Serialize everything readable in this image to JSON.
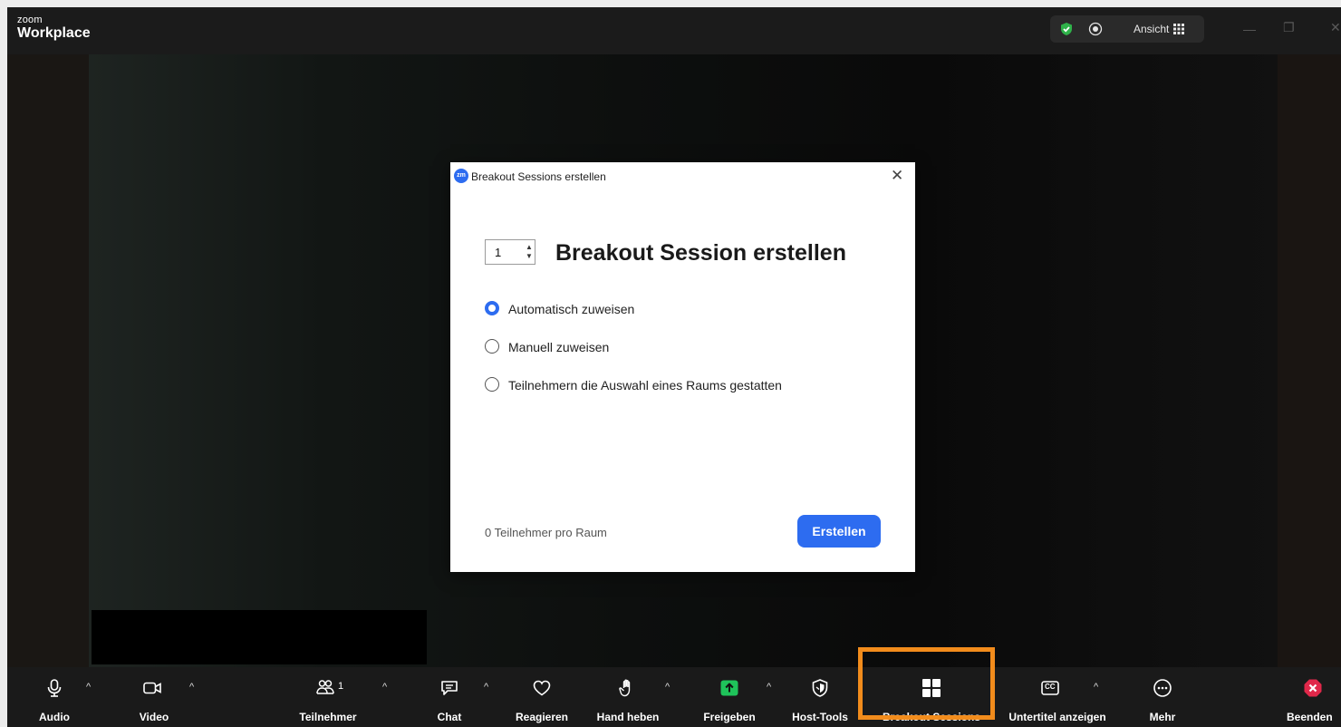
{
  "app": {
    "brand_top": "zoom",
    "brand_main": "Workplace"
  },
  "titlebar": {
    "view_label": "Ansicht"
  },
  "dialog": {
    "window_title": "Breakout Sessions erstellen",
    "app_icon": "zm",
    "session_count": "1",
    "heading": "Breakout Session erstellen",
    "options": [
      {
        "label": "Automatisch zuweisen",
        "selected": true
      },
      {
        "label": "Manuell zuweisen",
        "selected": false
      },
      {
        "label": "Teilnehmern die Auswahl eines Raums gestatten",
        "selected": false
      }
    ],
    "footer_text": "0 Teilnehmer pro Raum",
    "create_button": "Erstellen"
  },
  "toolbar": {
    "audio": "Audio",
    "video": "Video",
    "participants": "Teilnehmer",
    "participants_count": "1",
    "chat": "Chat",
    "react": "Reagieren",
    "raise_hand": "Hand heben",
    "share": "Freigeben",
    "host_tools": "Host-Tools",
    "breakout": "Breakout Sessions",
    "captions": "Untertitel anzeigen",
    "captions_icon_text": "CC",
    "more": "Mehr",
    "end": "Beenden"
  },
  "colors": {
    "accent": "#2d6cf0",
    "highlight": "#f28c1c",
    "shield": "#2fb24a",
    "share_green": "#1fc35a",
    "end_red": "#e0284a"
  }
}
